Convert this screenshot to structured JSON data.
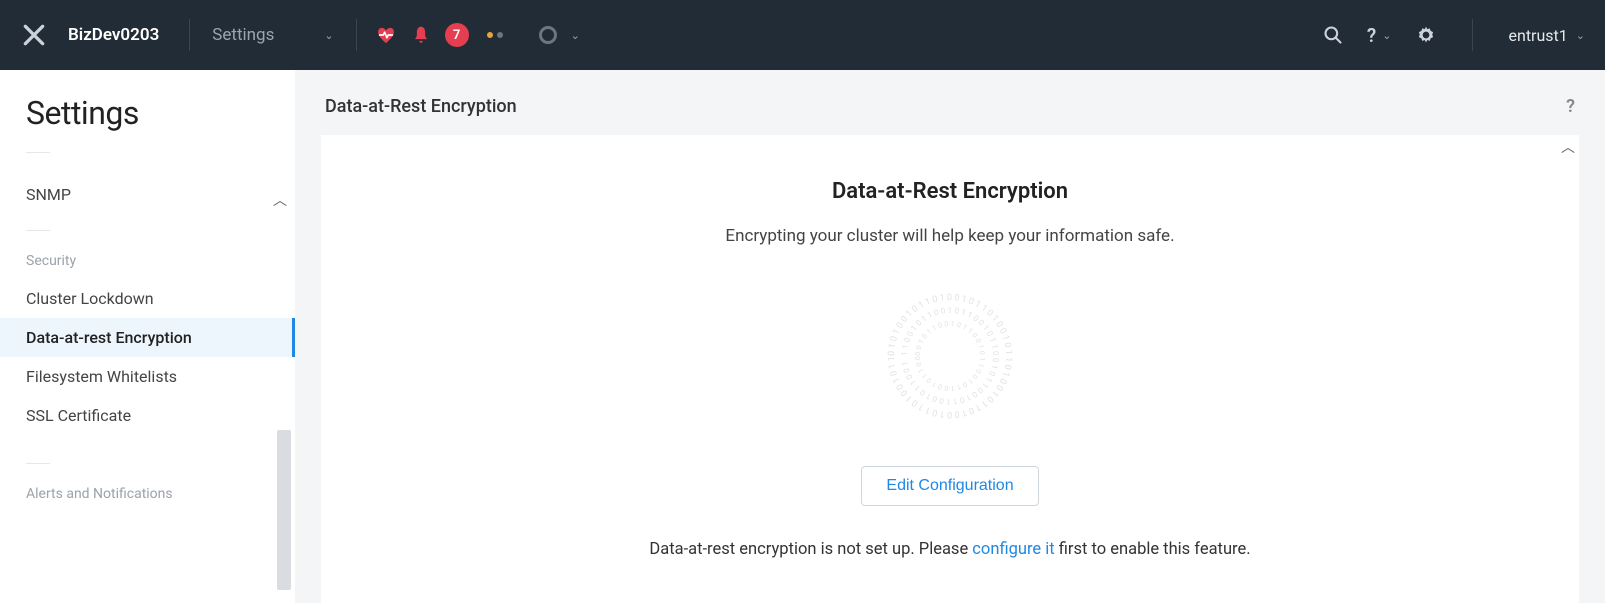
{
  "topbar": {
    "cluster_name": "BizDev0203",
    "nav_label": "Settings",
    "notification_count": "7",
    "user_label": "entrust1"
  },
  "sidebar": {
    "title": "Settings",
    "items": {
      "snmp": "SNMP",
      "security_label": "Security",
      "cluster_lockdown": "Cluster Lockdown",
      "data_at_rest": "Data-at-rest Encryption",
      "filesystem_whitelists": "Filesystem Whitelists",
      "ssl_certificate": "SSL Certificate",
      "alerts_label": "Alerts and Notifications"
    }
  },
  "content": {
    "header": "Data-at-Rest Encryption",
    "title": "Data-at-Rest Encryption",
    "subtitle": "Encrypting your cluster will help keep your information safe.",
    "button_label": "Edit Configuration",
    "status_prefix": "Data-at-rest encryption is not set up. Please ",
    "status_link": "configure it",
    "status_suffix": " first to enable this feature."
  }
}
